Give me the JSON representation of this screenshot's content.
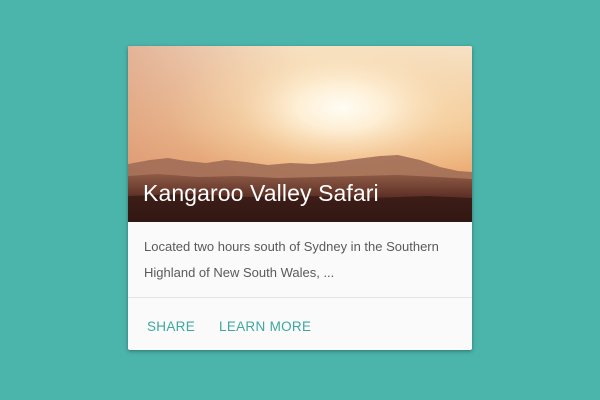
{
  "card": {
    "title": "Kangaroo Valley Safari",
    "supporting_text": "Located two hours south of Sydney in the Southern Highland of New South Wales, ...",
    "actions": [
      {
        "label": "SHARE"
      },
      {
        "label": "LEARN MORE"
      }
    ]
  },
  "colors": {
    "background": "#4bb5ab",
    "card": "#fafafa",
    "accent": "#3da89f",
    "title_text": "#ffffff",
    "body_text": "#5a5a5a"
  }
}
